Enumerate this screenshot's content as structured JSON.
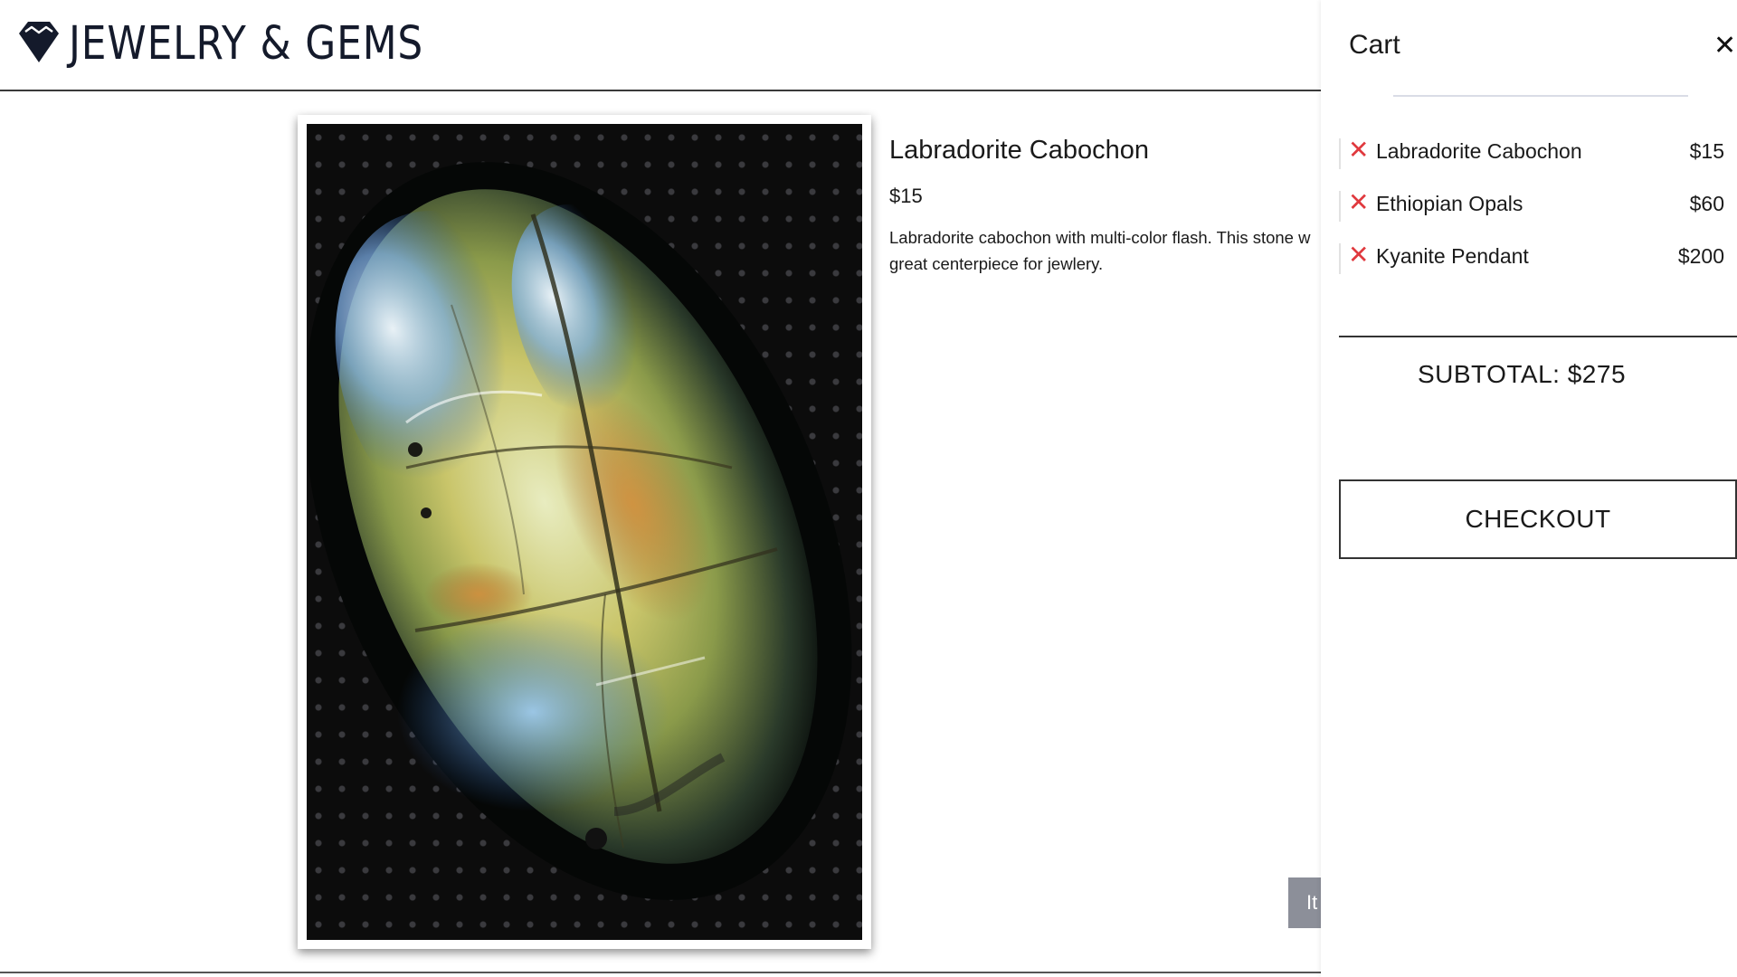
{
  "header": {
    "title": "JEWELRY & GEMS",
    "logo_icon": "diamond-icon"
  },
  "product": {
    "name": "Labradorite Cabochon",
    "price": "$15",
    "description": "Labradorite cabochon with multi-color flash. This stone w great centerpiece for jewlery.",
    "add_button_label": "It"
  },
  "cart": {
    "title": "Cart",
    "close_icon": "close-icon",
    "items": [
      {
        "name": "Labradorite Cabochon",
        "price": "$15",
        "remove_icon": "remove-x-icon"
      },
      {
        "name": "Ethiopian Opals",
        "price": "$60",
        "remove_icon": "remove-x-icon"
      },
      {
        "name": "Kyanite Pendant",
        "price": "$200",
        "remove_icon": "remove-x-icon"
      }
    ],
    "subtotal": "SUBTOTAL: $275",
    "checkout_label": "CHECKOUT"
  },
  "colors": {
    "brand_navy": "#141a2b",
    "remove_red": "#e0393e",
    "button_gray": "#8c8f99"
  }
}
